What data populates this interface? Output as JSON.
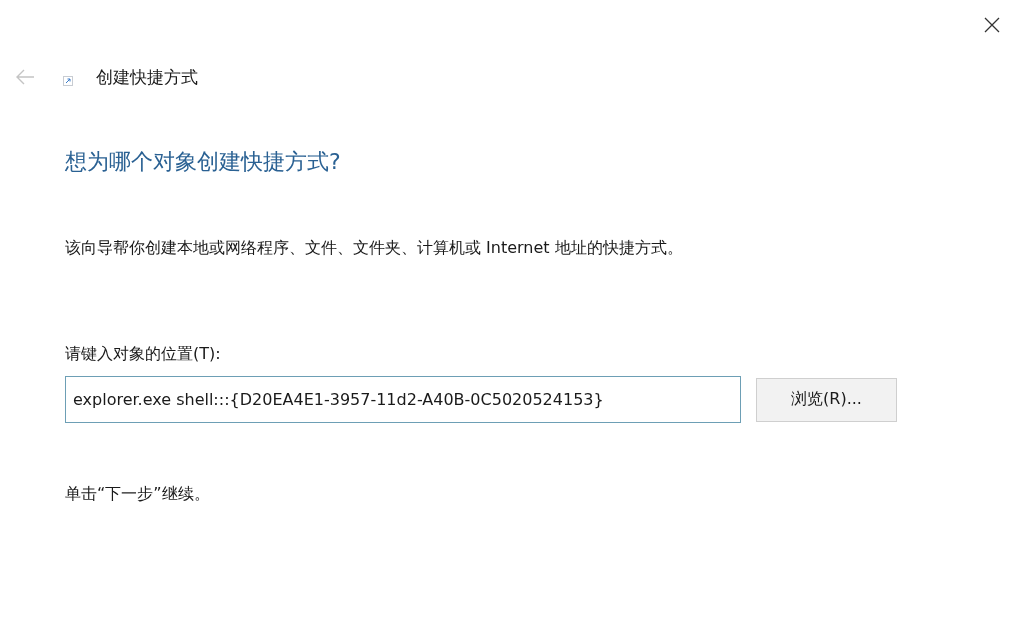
{
  "window": {
    "title": "创建快捷方式"
  },
  "back_button": {
    "disabled": true
  },
  "heading": "想为哪个对象创建快捷方式?",
  "description": "该向导帮你创建本地或网络程序、文件、文件夹、计算机或 Internet 地址的快捷方式。",
  "location": {
    "label": "请键入对象的位置(T):",
    "value": "explorer.exe shell:::{D20EA4E1-3957-11d2-A40B-0C5020524153}"
  },
  "browse_button": "浏览(R)...",
  "hint": "单击“下一步”继续。"
}
